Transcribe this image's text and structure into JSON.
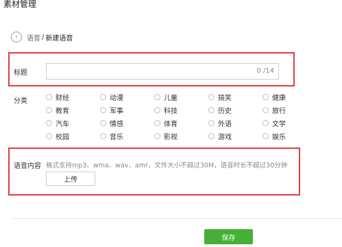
{
  "app_title": "素材管理",
  "breadcrumb": {
    "back_glyph": "‹",
    "parent": "语音",
    "separator": "/",
    "current": "新建语音"
  },
  "title_field": {
    "label": "标题",
    "value": "",
    "counter": "0 /14"
  },
  "category": {
    "label": "分类",
    "options": [
      {
        "label": "财经"
      },
      {
        "label": "动漫"
      },
      {
        "label": "儿童"
      },
      {
        "label": "搞笑"
      },
      {
        "label": "健康"
      },
      {
        "label": "教育"
      },
      {
        "label": "军事"
      },
      {
        "label": "科技"
      },
      {
        "label": "历史"
      },
      {
        "label": "旅行"
      },
      {
        "label": "汽车"
      },
      {
        "label": "情感"
      },
      {
        "label": "体育"
      },
      {
        "label": "外语"
      },
      {
        "label": "文学"
      },
      {
        "label": "校园"
      },
      {
        "label": "音乐"
      },
      {
        "label": "影视"
      },
      {
        "label": "游戏"
      },
      {
        "label": "娱乐"
      }
    ]
  },
  "voice": {
    "label": "语音内容",
    "hint": "格式支持mp3、wma、wav、amr，文件大小不超过30M，语音时长不超过30分钟",
    "upload_label": "上传"
  },
  "save_label": "保存",
  "colors": {
    "accent_green": "#45b035",
    "highlight_red": "#e23b3b"
  }
}
